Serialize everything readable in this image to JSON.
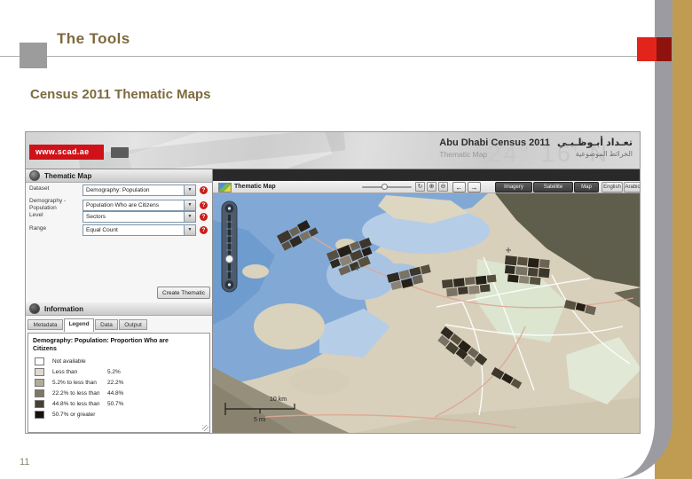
{
  "slide": {
    "title": "The Tools",
    "subtitle": "Census 2011 Thematic Maps",
    "page_number": "11",
    "accent_red": "#e3241b",
    "accent_tan": "#bf9c52",
    "accent_gray": "#9b9ba1"
  },
  "icons": {
    "dropdown": "▼",
    "help": "?",
    "info": "i",
    "refresh": "↻",
    "zoom_in": "⊕",
    "zoom_out": "⊖",
    "back": "←",
    "forward": "→"
  },
  "app": {
    "banner": {
      "site_badge": "www.scad.ae",
      "title_en": "Abu Dhabi Census 2011",
      "title_ar": "تعـداد أبـوظـبـي",
      "subtitle_en": "Thematic Map",
      "subtitle_ar": "الخرائط الموضوعية",
      "watermark": "24° 16' N"
    },
    "panel": {
      "header": "Thematic Map",
      "fields": [
        {
          "label": "Dataset",
          "value": "Demography: Population"
        },
        {
          "label": "Demography - Population",
          "value": "Population Who are Citizens"
        },
        {
          "label": "Level",
          "value": "Sectors"
        },
        {
          "label": "Range",
          "value": "Equal Count"
        }
      ],
      "create_button": "Create Thematic",
      "info_header": "Information",
      "tabs": [
        "Metadata",
        "Legend",
        "Data",
        "Output"
      ],
      "active_tab": "Legend",
      "legend": {
        "title": "Demography: Population: Proportion Who are Citizens",
        "items": [
          {
            "swatch": "#ffffff",
            "text": "Not available",
            "value": ""
          },
          {
            "swatch": "#dfdacf",
            "text": "Less than",
            "value": "5.2%"
          },
          {
            "swatch": "#b3ab99",
            "text": "5.2% to less than",
            "value": "22.2%"
          },
          {
            "swatch": "#7f7765",
            "text": "22.2% to less than",
            "value": "44.8%"
          },
          {
            "swatch": "#474034",
            "text": "44.8% to less than",
            "value": "50.7%"
          },
          {
            "swatch": "#15120d",
            "text": "50.7% or greater",
            "value": ""
          }
        ]
      }
    },
    "map": {
      "tab_label": "Thematic Map",
      "basemap_buttons": [
        "Imagery",
        "Satellite",
        "Map"
      ],
      "language_buttons": [
        "English",
        "Arabic"
      ],
      "scale_km": "10 km",
      "scale_mi": "5 mi"
    }
  }
}
